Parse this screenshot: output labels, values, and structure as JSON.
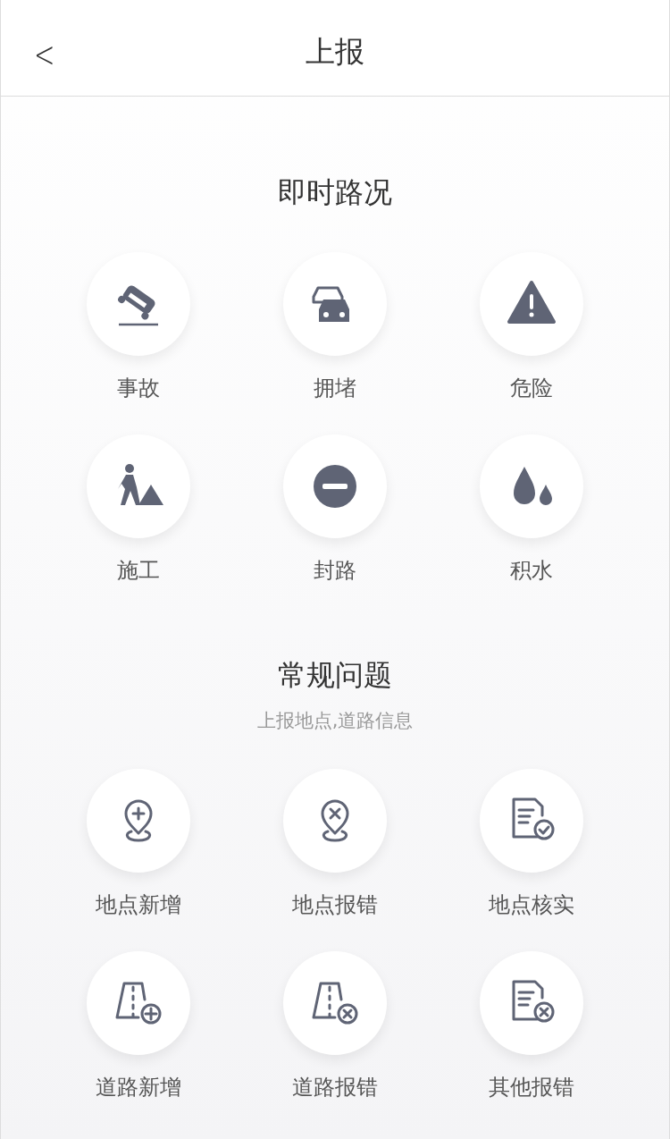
{
  "header": {
    "back": "<",
    "title": "上报"
  },
  "sections": [
    {
      "title": "即时路况",
      "items": [
        {
          "kind": "accident",
          "label": "事故"
        },
        {
          "kind": "congestion",
          "label": "拥堵"
        },
        {
          "kind": "danger",
          "label": "危险"
        },
        {
          "kind": "construction",
          "label": "施工"
        },
        {
          "kind": "closure",
          "label": "封路"
        },
        {
          "kind": "water",
          "label": "积水"
        }
      ]
    },
    {
      "title": "常规问题",
      "subtitle": "上报地点,道路信息",
      "items": [
        {
          "kind": "place-add",
          "label": "地点新增"
        },
        {
          "kind": "place-error",
          "label": "地点报错"
        },
        {
          "kind": "place-verify",
          "label": "地点核实"
        },
        {
          "kind": "road-add",
          "label": "道路新增"
        },
        {
          "kind": "road-error",
          "label": "道路报错"
        },
        {
          "kind": "doc-error",
          "label": "其他报错"
        }
      ]
    }
  ]
}
